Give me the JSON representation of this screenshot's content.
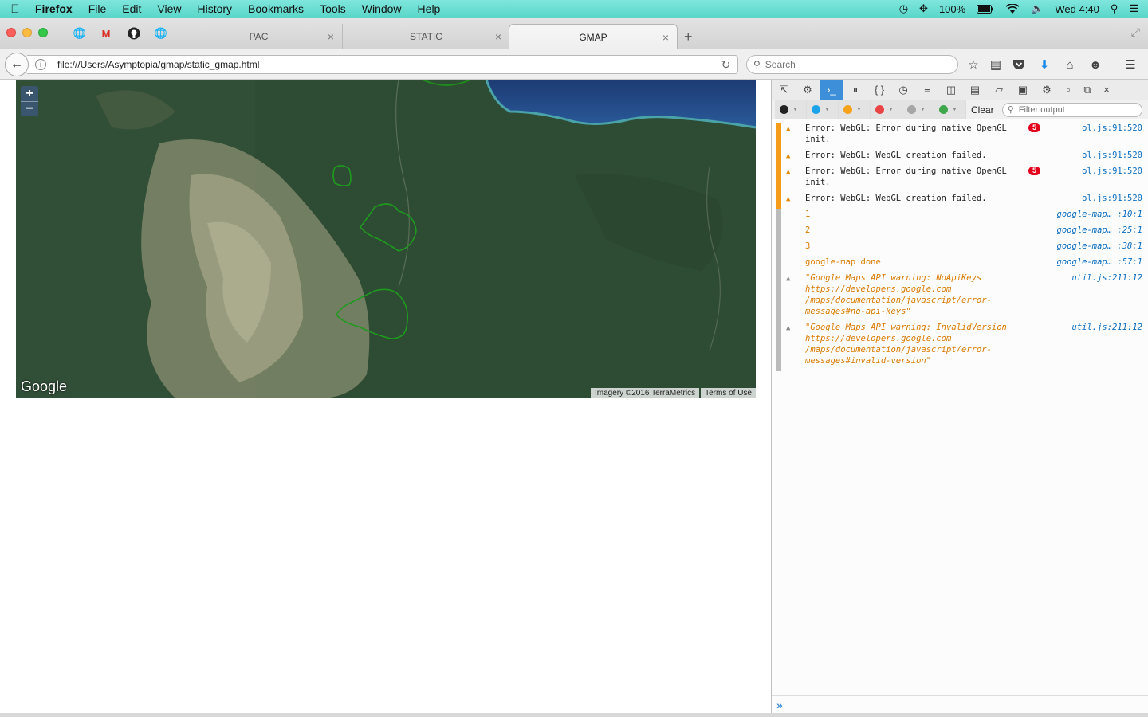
{
  "menubar": {
    "app_name": "Firefox",
    "items": [
      "File",
      "Edit",
      "View",
      "History",
      "Bookmarks",
      "Tools",
      "Window",
      "Help"
    ],
    "battery": "100%",
    "clock": "Wed 4:40"
  },
  "tabs": {
    "items": [
      {
        "label": "PAC"
      },
      {
        "label": "STATIC"
      },
      {
        "label": "GMAP"
      }
    ],
    "close_glyph": "×",
    "new_tab_glyph": "+"
  },
  "navbar": {
    "url": "file:///Users/Asymptopia/gmap/static_gmap.html",
    "search_placeholder": "Search"
  },
  "map": {
    "zoom_in": "+",
    "zoom_out": "−",
    "logo": "Google",
    "imagery": "Imagery ©2016 TerraMetrics",
    "terms": "Terms of Use"
  },
  "devtools": {
    "clear_label": "Clear",
    "filter_placeholder": "Filter output",
    "filter_colors": [
      "#222222",
      "#1ba3ea",
      "#f6a21a",
      "#ea4345",
      "#a6a6a6",
      "#3fa64c"
    ],
    "logs": [
      {
        "type": "error",
        "message": "Error: WebGL: Error during native OpenGL\ninit.",
        "repeat": "5",
        "source": "ol.js:91:520"
      },
      {
        "type": "error",
        "message": "Error: WebGL: WebGL creation failed.",
        "repeat": "",
        "source": "ol.js:91:520"
      },
      {
        "type": "error",
        "message": "Error: WebGL: Error during native OpenGL\ninit.",
        "repeat": "5",
        "source": "ol.js:91:520"
      },
      {
        "type": "error",
        "message": "Error: WebGL: WebGL creation failed.",
        "repeat": "",
        "source": "ol.js:91:520"
      },
      {
        "type": "log",
        "message": "1",
        "repeat": "",
        "source": "google-map… :10:1"
      },
      {
        "type": "log",
        "message": "2",
        "repeat": "",
        "source": "google-map… :25:1"
      },
      {
        "type": "log",
        "message": "3",
        "repeat": "",
        "source": "google-map… :38:1"
      },
      {
        "type": "log",
        "message": "google-map done",
        "repeat": "",
        "source": "google-map… :57:1"
      },
      {
        "type": "warn",
        "message": "\"Google Maps API warning: NoApiKeys\nhttps://developers.google.com\n/maps/documentation/javascript/error-\nmessages#no-api-keys\"",
        "repeat": "",
        "source": "util.js:211:12"
      },
      {
        "type": "warn",
        "message": "\"Google Maps API warning: InvalidVersion\nhttps://developers.google.com\n/maps/documentation/javascript/error-\nmessages#invalid-version\"",
        "repeat": "",
        "source": "util.js:211:12"
      }
    ]
  }
}
